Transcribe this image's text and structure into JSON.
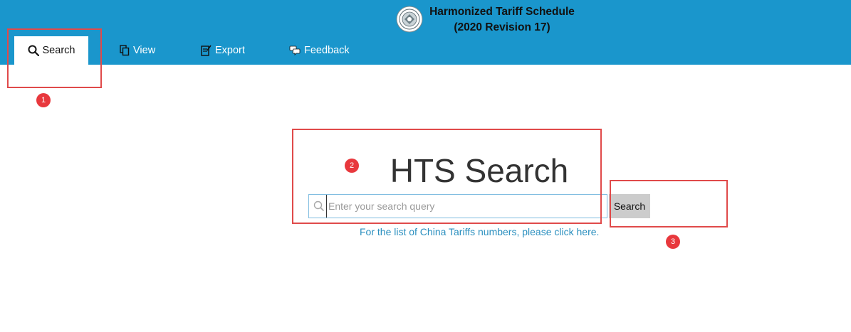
{
  "header": {
    "title_line1": "Harmonized Tariff Schedule",
    "title_line2": "(2020 Revision 17)",
    "seal_icon": "seal-icon"
  },
  "tabs": [
    {
      "label": "Search",
      "icon": "search-icon",
      "active": true
    },
    {
      "label": "View",
      "icon": "copy-icon",
      "active": false
    },
    {
      "label": "Export",
      "icon": "edit-icon",
      "active": false
    },
    {
      "label": "Feedback",
      "icon": "chat-icon",
      "active": false
    }
  ],
  "main": {
    "heading": "HTS Search",
    "search_placeholder": "Enter your search query",
    "search_value": "",
    "search_button": "Search",
    "china_link": "For the list of China Tariffs numbers, please click here."
  },
  "annotations": [
    "1",
    "2",
    "3"
  ],
  "colors": {
    "header_bg": "#1a96cc",
    "annotation": "#e04a4a",
    "link": "#2a8fbf"
  }
}
